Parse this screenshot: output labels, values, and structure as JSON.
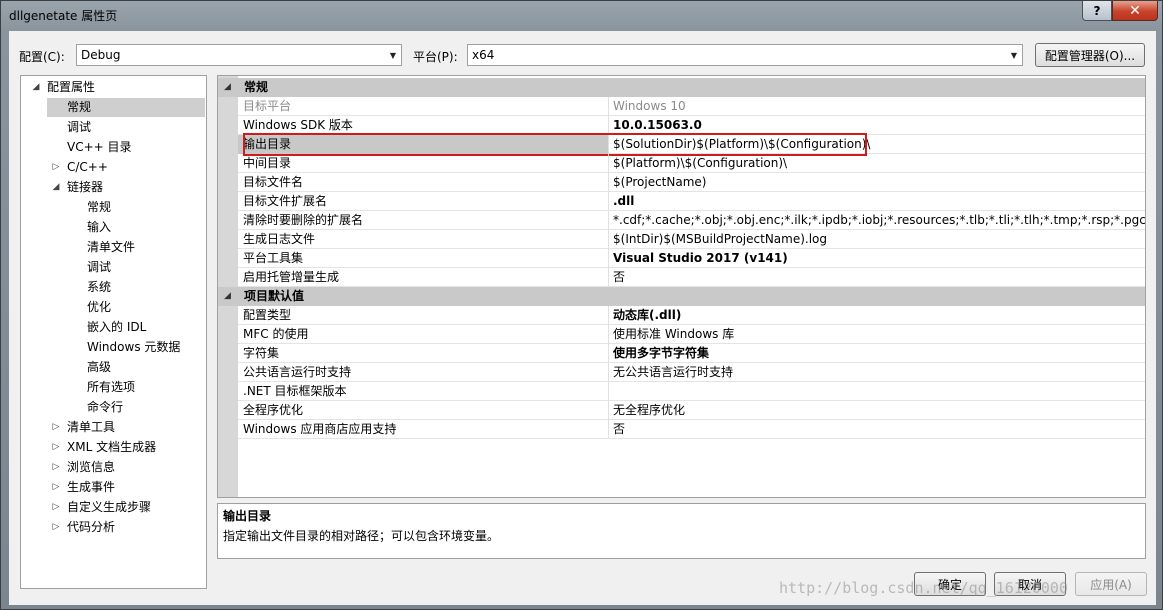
{
  "window": {
    "title": "dllgenetate 属性页",
    "help_label": "?",
    "close_label": "✕"
  },
  "toolbar": {
    "config_label": "配置(C):",
    "config_value": "Debug",
    "platform_label": "平台(P):",
    "platform_value": "x64",
    "config_manager_label": "配置管理器(O)..."
  },
  "tree": [
    {
      "label": "配置属性",
      "level": 0,
      "state": "expanded"
    },
    {
      "label": "常规",
      "level": 1,
      "state": "leaf",
      "selected": true
    },
    {
      "label": "调试",
      "level": 1,
      "state": "leaf"
    },
    {
      "label": "VC++ 目录",
      "level": 1,
      "state": "leaf"
    },
    {
      "label": "C/C++",
      "level": 1,
      "state": "collapsed"
    },
    {
      "label": "链接器",
      "level": 1,
      "state": "expanded"
    },
    {
      "label": "常规",
      "level": 2,
      "state": "leaf"
    },
    {
      "label": "输入",
      "level": 2,
      "state": "leaf"
    },
    {
      "label": "清单文件",
      "level": 2,
      "state": "leaf"
    },
    {
      "label": "调试",
      "level": 2,
      "state": "leaf"
    },
    {
      "label": "系统",
      "level": 2,
      "state": "leaf"
    },
    {
      "label": "优化",
      "level": 2,
      "state": "leaf"
    },
    {
      "label": "嵌入的 IDL",
      "level": 2,
      "state": "leaf"
    },
    {
      "label": "Windows 元数据",
      "level": 2,
      "state": "leaf"
    },
    {
      "label": "高级",
      "level": 2,
      "state": "leaf"
    },
    {
      "label": "所有选项",
      "level": 2,
      "state": "leaf"
    },
    {
      "label": "命令行",
      "level": 2,
      "state": "leaf"
    },
    {
      "label": "清单工具",
      "level": 1,
      "state": "collapsed"
    },
    {
      "label": "XML 文档生成器",
      "level": 1,
      "state": "collapsed"
    },
    {
      "label": "浏览信息",
      "level": 1,
      "state": "collapsed"
    },
    {
      "label": "生成事件",
      "level": 1,
      "state": "collapsed"
    },
    {
      "label": "自定义生成步骤",
      "level": 1,
      "state": "collapsed"
    },
    {
      "label": "代码分析",
      "level": 1,
      "state": "collapsed"
    }
  ],
  "grid": {
    "sections": [
      {
        "title": "常规",
        "rows": [
          {
            "key": "目标平台",
            "value": "Windows 10",
            "dim": true
          },
          {
            "key": "Windows SDK 版本",
            "value": "10.0.15063.0",
            "bold": true
          },
          {
            "key": "输出目录",
            "value": "$(SolutionDir)$(Platform)\\$(Configuration)\\",
            "selected": true
          },
          {
            "key": "中间目录",
            "value": "$(Platform)\\$(Configuration)\\"
          },
          {
            "key": "目标文件名",
            "value": "$(ProjectName)"
          },
          {
            "key": "目标文件扩展名",
            "value": ".dll",
            "bold": true
          },
          {
            "key": "清除时要删除的扩展名",
            "value": "*.cdf;*.cache;*.obj;*.obj.enc;*.ilk;*.ipdb;*.iobj;*.resources;*.tlb;*.tli;*.tlh;*.tmp;*.rsp;*.pgc;*.pgd;*."
          },
          {
            "key": "生成日志文件",
            "value": "$(IntDir)$(MSBuildProjectName).log"
          },
          {
            "key": "平台工具集",
            "value": "Visual Studio 2017 (v141)",
            "bold": true
          },
          {
            "key": "启用托管增量生成",
            "value": "否"
          }
        ]
      },
      {
        "title": "项目默认值",
        "rows": [
          {
            "key": "配置类型",
            "value": "动态库(.dll)",
            "bold": true
          },
          {
            "key": "MFC 的使用",
            "value": "使用标准 Windows 库"
          },
          {
            "key": "字符集",
            "value": "使用多字节字符集",
            "bold": true
          },
          {
            "key": "公共语言运行时支持",
            "value": "无公共语言运行时支持"
          },
          {
            "key": ".NET 目标框架版本",
            "value": ""
          },
          {
            "key": "全程序优化",
            "value": "无全程序优化"
          },
          {
            "key": "Windows 应用商店应用支持",
            "value": "否"
          }
        ]
      }
    ]
  },
  "description": {
    "title": "输出目录",
    "text": "指定输出文件目录的相对路径；可以包含环境变量。"
  },
  "buttons": {
    "ok": "确定",
    "cancel": "取消",
    "apply": "应用(A)"
  },
  "watermark": "http://blog.csdn.net/qq_16120000"
}
